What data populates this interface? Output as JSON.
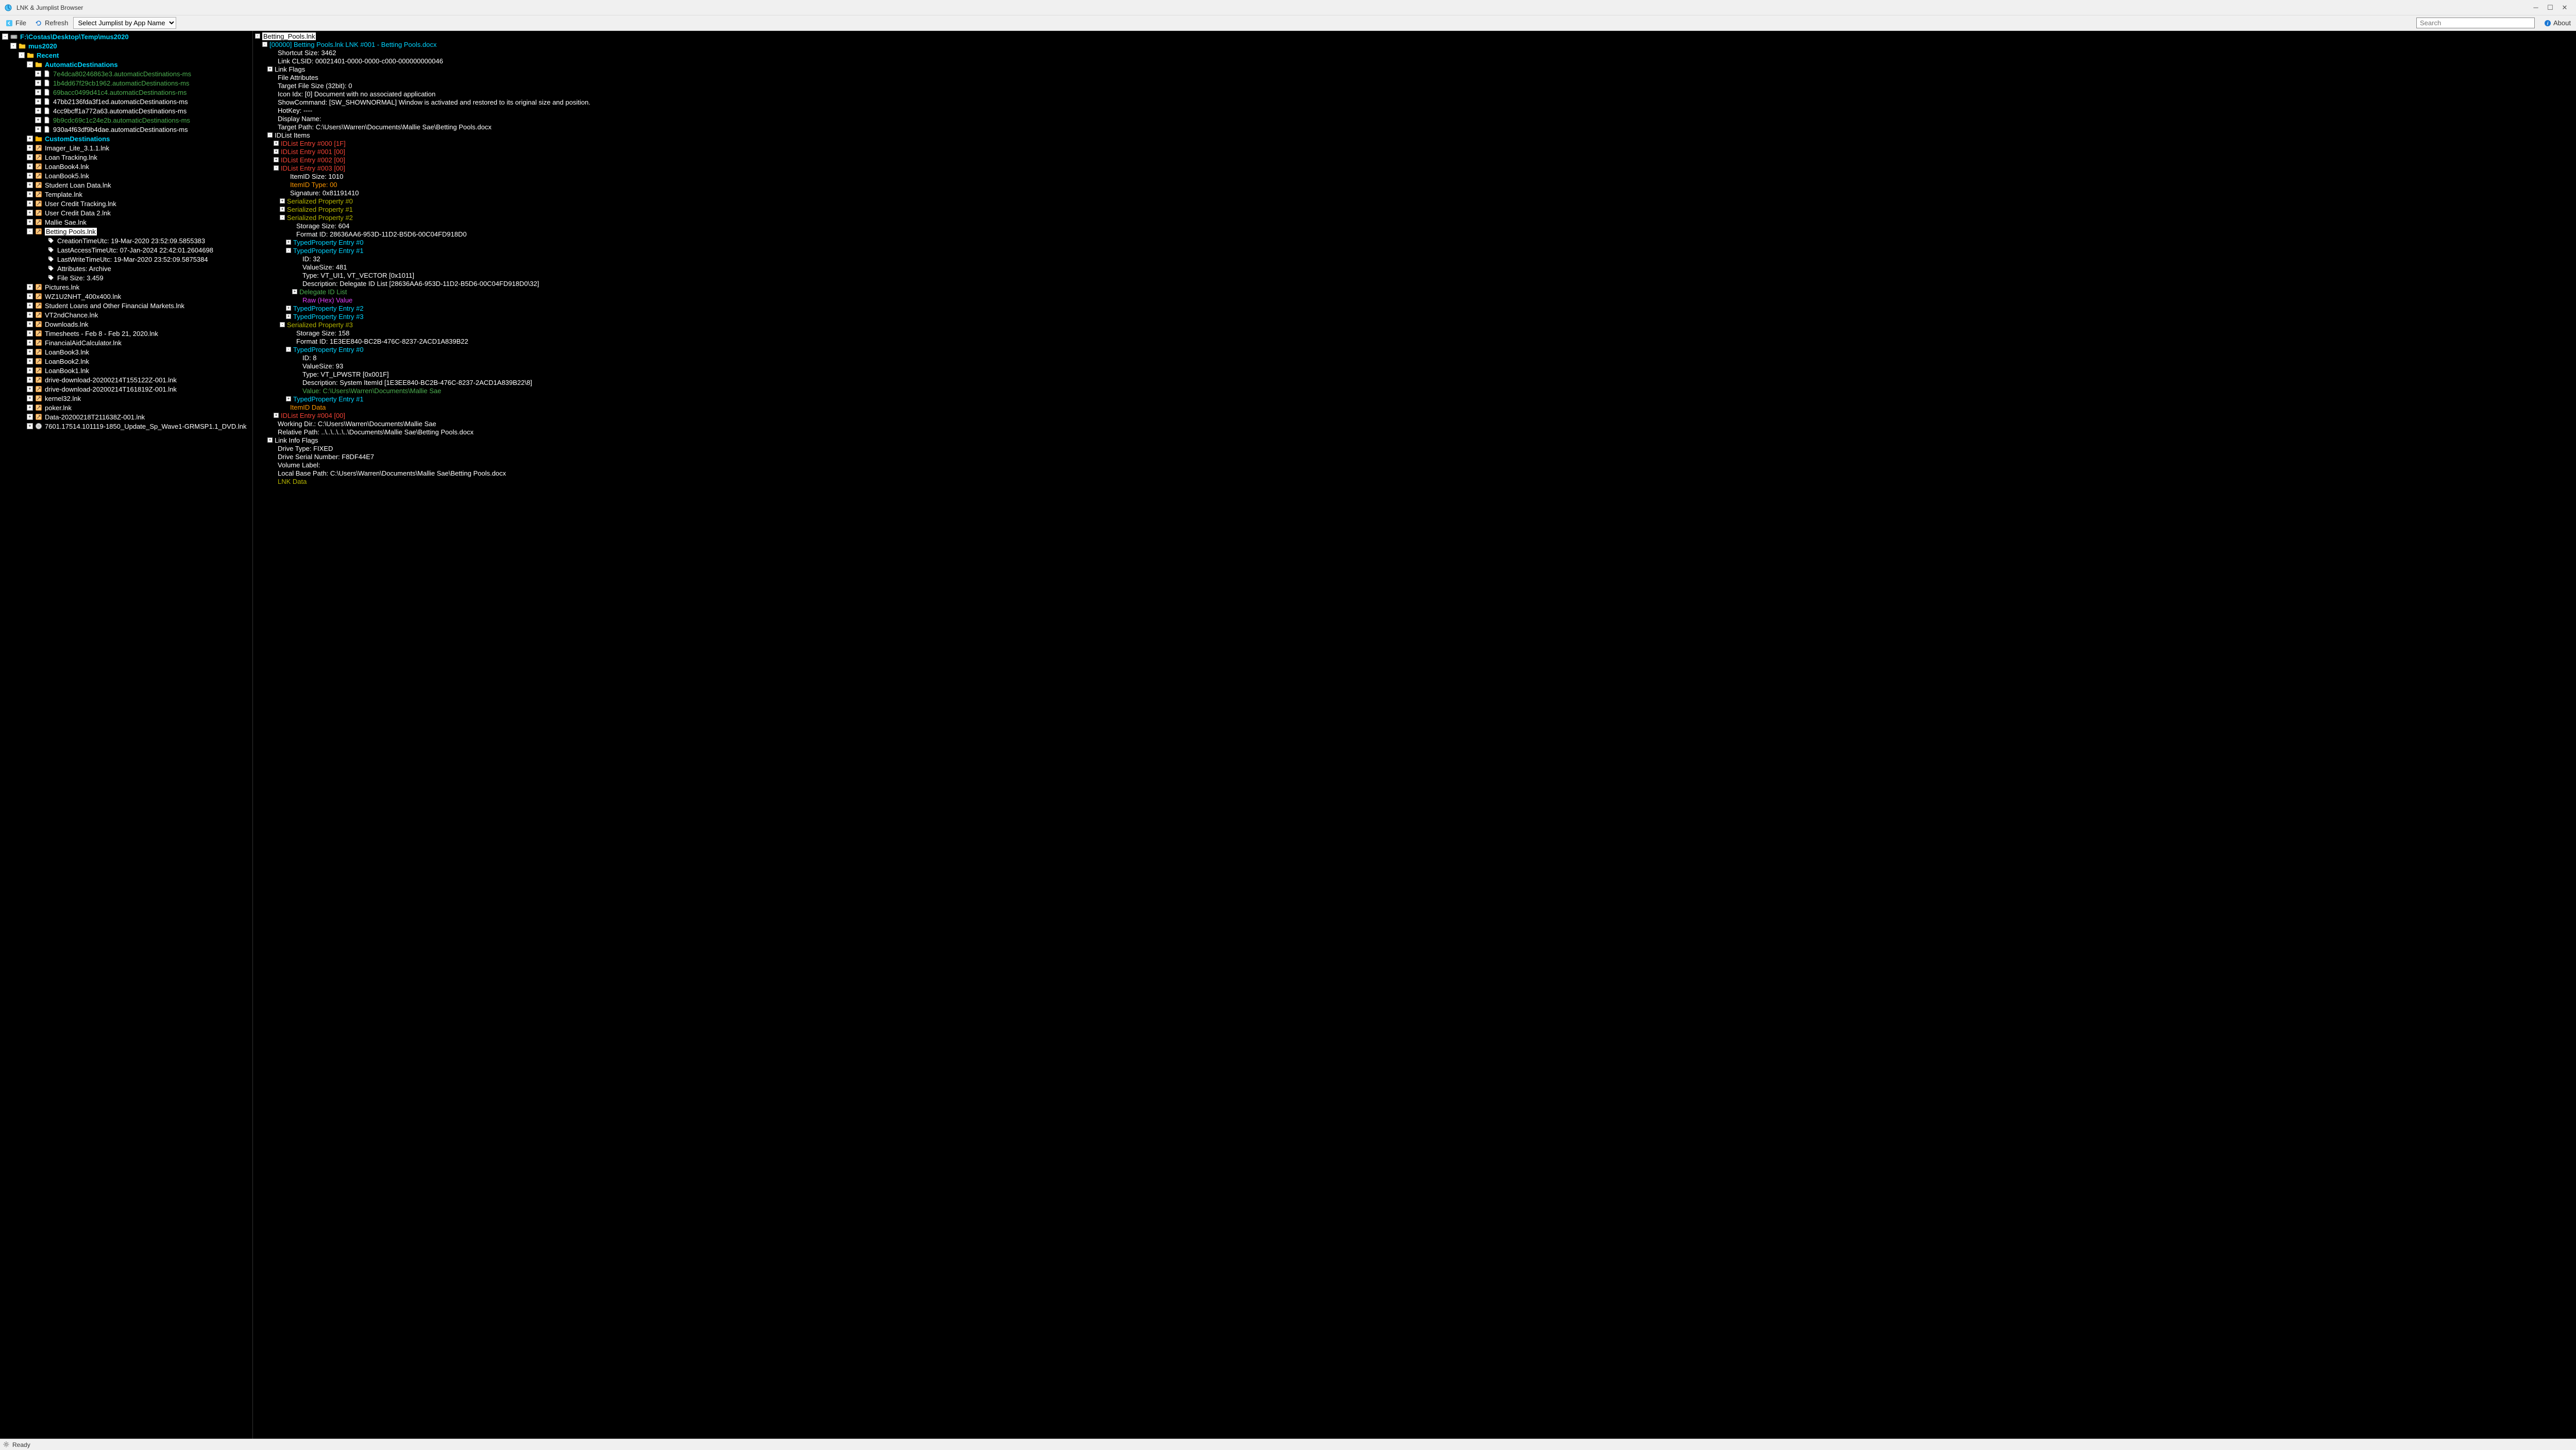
{
  "window": {
    "title": "LNK & Jumplist Browser"
  },
  "toolbar": {
    "file": "File",
    "refresh": "Refresh",
    "jumplist_placeholder": "Select Jumplist by App Name",
    "search_placeholder": "Search",
    "about": "About"
  },
  "tree": {
    "root": "F:\\Costas\\Desktop\\Temp\\mus2020",
    "mus": "mus2020",
    "recent": "Recent",
    "auto": "AutomaticDestinations",
    "auto_items": [
      "7e4dca80246863e3.automaticDestinations-ms",
      "1b4dd67f29cb1962.automaticDestinations-ms",
      "69bacc0499d41c4.automaticDestinations-ms",
      "47bb2136fda3f1ed.automaticDestinations-ms",
      "4cc9bcff1a772a63.automaticDestinations-ms",
      "9b9cdc69c1c24e2b.automaticDestinations-ms",
      "930a4f63df9b4dae.automaticDestinations-ms"
    ],
    "custom": "CustomDestinations",
    "lnks_a": [
      "Imager_Lite_3.1.1.lnk",
      "Loan Tracking.lnk",
      "LoanBook4.lnk",
      "LoanBook5.lnk",
      "Student Loan Data.lnk",
      "Template.lnk",
      "User Credit Tracking.lnk",
      "User Credit Data 2.lnk",
      "Mallie Sae.lnk"
    ],
    "selected": "Betting Pools.lnk",
    "selected_children": [
      "CreationTimeUtc: 19-Mar-2020 23:52:09.5855383",
      "LastAccessTimeUtc: 07-Jan-2024 22:42:01.2604698",
      "LastWriteTimeUtc: 19-Mar-2020 23:52:09.5875384",
      "Attributes: Archive",
      "File Size: 3.459"
    ],
    "lnks_b": [
      "Pictures.lnk",
      "WZ1U2NHT_400x400.lnk",
      "Student Loans and Other Financial Markets.lnk",
      "VT2ndChance.lnk",
      "Downloads.lnk",
      "Timesheets - Feb 8 - Feb 21, 2020.lnk",
      "FinancialAidCalculator.lnk",
      "LoanBook3.lnk",
      "LoanBook2.lnk",
      "LoanBook1.lnk",
      "drive-download-20200214T155122Z-001.lnk",
      "drive-download-20200214T161819Z-001.lnk",
      "kernel32.lnk",
      "poker.lnk",
      "Data-20200218T211638Z-001.lnk",
      "7601.17514.101119-1850_Update_Sp_Wave1-GRMSP1.1_DVD.lnk"
    ]
  },
  "details": {
    "file": "Betting_Pools.lnk",
    "header": "[00000] Betting Pools.lnk LNK #001 - Betting Pools.docx",
    "shortcut_size": "Shortcut Size: 3462",
    "clsid": "Link CLSID: 00021401-0000-0000-c000-000000000046",
    "link_flags": "Link Flags",
    "file_attr": "File Attributes",
    "target_size": "Target File Size (32bit): 0",
    "icon_idx": "Icon Idx: [0] Document with no associated application",
    "showcmd": "ShowCommand: [SW_SHOWNORMAL] Window is activated and restored to its original size and position.",
    "hotkey": "HotKey: ----",
    "display_name": "Display Name:",
    "target_path": "Target Path: C:\\Users\\Warren\\Documents\\Mallie Sae\\Betting Pools.docx",
    "idlist": "IDList Items",
    "idlist_entries": [
      "IDList Entry #000 [1F]",
      "IDList Entry #001 [00]",
      "IDList Entry #002 [00]",
      "IDList Entry #003 [00]"
    ],
    "itemid_size": "ItemID Size: 1010",
    "itemid_type": "ItemID Type: 00",
    "signature": "Signature: 0x81191410",
    "serprop0": "Serialized Property #0",
    "serprop1": "Serialized Property #1",
    "serprop2": "Serialized Property #2",
    "storage_size2": "Storage Size: 604",
    "format_id2": "Format ID: 28636AA6-953D-11D2-B5D6-00C04FD918D0",
    "typed0": "TypedProperty Entry #0",
    "typed1": "TypedProperty Entry #1",
    "t1_id": "ID: 32",
    "t1_vs": "ValueSize: 481",
    "t1_type": "Type: VT_UI1, VT_VECTOR [0x1011]",
    "t1_desc": "Description: Delegate ID List [28636AA6-953D-11D2-B5D6-00C04FD918D0\\32]",
    "delegate": "Delegate ID List",
    "rawhex": "Raw (Hex) Value",
    "typed2": "TypedProperty Entry #2",
    "typed3": "TypedProperty Entry #3",
    "serprop3": "Serialized Property #3",
    "storage_size3": "Storage Size: 158",
    "format_id3": "Format ID: 1E3EE840-BC2B-476C-8237-2ACD1A839B22",
    "typed3_0": "TypedProperty Entry #0",
    "t30_id": "ID: 8",
    "t30_vs": "ValueSize: 93",
    "t30_type": "Type: VT_LPWSTR [0x001F]",
    "t30_desc": "Description: System ItemId [1E3EE840-BC2B-476C-8237-2ACD1A839B22\\8]",
    "t30_val": "Value: C:\\Users\\Warren\\Documents\\Mallie Sae",
    "typed3_1": "TypedProperty Entry #1",
    "itemid_data": "ItemID Data",
    "idlist4": "IDList Entry #004 [00]",
    "working_dir": "Working Dir.: C:\\Users\\Warren\\Documents\\Mallie Sae",
    "rel_path": "Relative Path: ..\\..\\..\\..\\..\\Documents\\Mallie Sae\\Betting Pools.docx",
    "link_info": "Link Info Flags",
    "drive_type": "Drive Type: FIXED",
    "drive_serial": "Drive Serial Number: F8DF44E7",
    "vol_label": "Volume Label:",
    "local_base": "Local Base Path: C:\\Users\\Warren\\Documents\\Mallie Sae\\Betting Pools.docx",
    "lnk_data": "LNK Data"
  },
  "status": "Ready"
}
